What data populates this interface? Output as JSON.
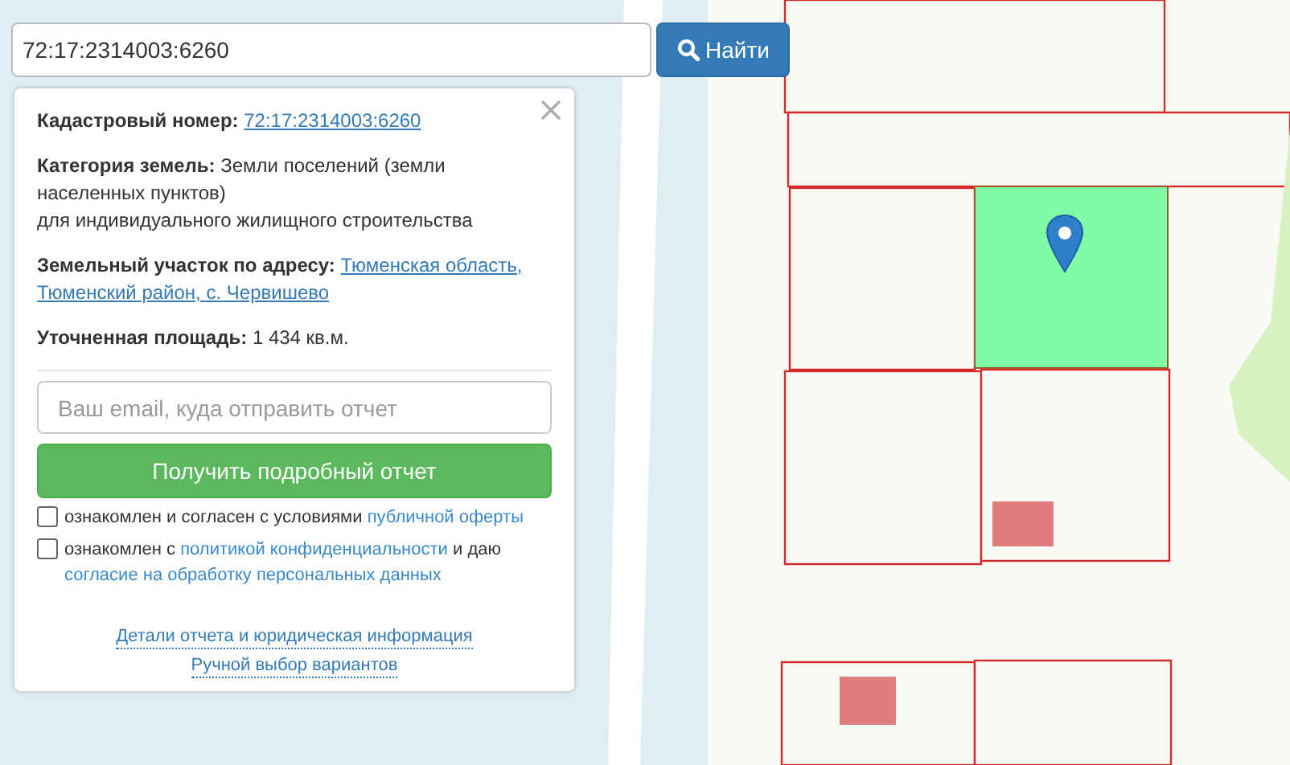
{
  "search": {
    "value": "72:17:2314003:6260",
    "button": "Найти"
  },
  "info": {
    "fields": [
      {
        "label": "Кадастровый номер:",
        "value": "72:17:2314003:6260",
        "kind": "link"
      },
      {
        "label": "Категория земель:",
        "value": "Земли поселений (земли населенных пунктов)",
        "note": "для индивидуального жилищного строительства",
        "kind": "text"
      },
      {
        "label": "Земельный участок по адресу:",
        "value": "Тюменская область,",
        "value_line_2": "Тюменский район, с. Червишево",
        "kind": "link"
      },
      {
        "label": "Уточненная площадь:",
        "value": "1 434 кв.м.",
        "kind": "text"
      }
    ],
    "email": {
      "placeholder": "Ваш email, куда отправить отчет"
    },
    "submit": "Получить подробный отчет",
    "consents": [
      {
        "checked": false,
        "parts": [
          {
            "text": "ознакомлен и согласен с условиями ",
            "kind": "text"
          },
          {
            "text": "публичной оферты",
            "kind": "link"
          }
        ]
      },
      {
        "checked": false,
        "parts": [
          {
            "text": "ознакомлен с ",
            "kind": "text"
          },
          {
            "text": "политикой конфиденциальности",
            "kind": "link"
          },
          {
            "text": " и даю ",
            "kind": "text"
          },
          {
            "text": "согласие на обработку персональных данных",
            "kind": "link"
          }
        ]
      }
    ],
    "footer_links": [
      "Детали отчета и юридическая информация",
      "Ручной выбор вариантов"
    ]
  }
}
